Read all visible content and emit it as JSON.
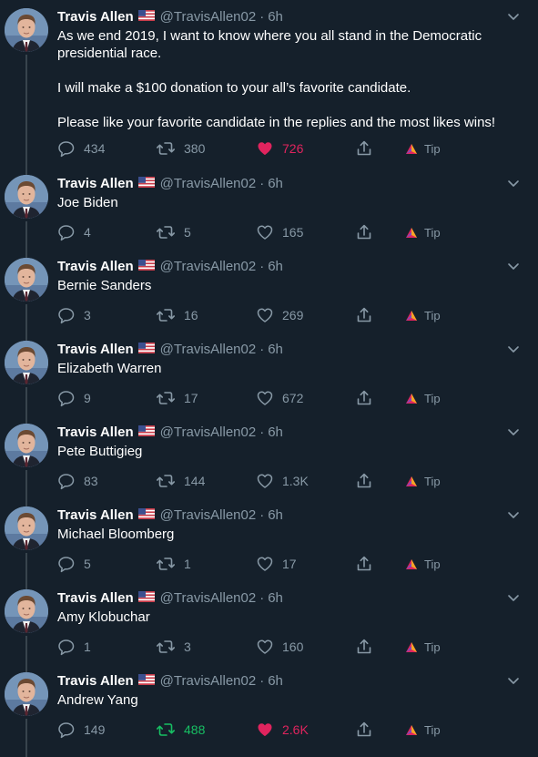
{
  "author": {
    "name": "Travis Allen",
    "handle": "@TravisAllen02",
    "time": "6h",
    "flag_icon": "us-flag-icon"
  },
  "colors": {
    "background": "#15202b",
    "text": "#ffffff",
    "muted": "#8899a6",
    "like_active": "#e0245e",
    "retweet_active": "#17bf63",
    "thread_line": "#38444d"
  },
  "tweets": [
    {
      "paragraphs": [
        "As we end 2019, I want to know where you all stand in the Democratic presidential race.",
        "I will make a $100 donation to your all’s favorite candidate.",
        "Please like your favorite candidate in the replies and the most likes wins!"
      ],
      "replies": "434",
      "retweets": "380",
      "likes": "726",
      "liked": true,
      "retweeted": false,
      "tip_label": "Tip"
    },
    {
      "paragraphs": [
        "Joe Biden"
      ],
      "replies": "4",
      "retweets": "5",
      "likes": "165",
      "liked": false,
      "retweeted": false,
      "tip_label": "Tip"
    },
    {
      "paragraphs": [
        "Bernie Sanders"
      ],
      "replies": "3",
      "retweets": "16",
      "likes": "269",
      "liked": false,
      "retweeted": false,
      "tip_label": "Tip"
    },
    {
      "paragraphs": [
        "Elizabeth Warren"
      ],
      "replies": "9",
      "retweets": "17",
      "likes": "672",
      "liked": false,
      "retweeted": false,
      "tip_label": "Tip"
    },
    {
      "paragraphs": [
        "Pete Buttigieg"
      ],
      "replies": "83",
      "retweets": "144",
      "likes": "1.3K",
      "liked": false,
      "retweeted": false,
      "tip_label": "Tip"
    },
    {
      "paragraphs": [
        "Michael Bloomberg"
      ],
      "replies": "5",
      "retweets": "1",
      "likes": "17",
      "liked": false,
      "retweeted": false,
      "tip_label": "Tip"
    },
    {
      "paragraphs": [
        "Amy Klobuchar"
      ],
      "replies": "1",
      "retweets": "3",
      "likes": "160",
      "liked": false,
      "retweeted": false,
      "tip_label": "Tip"
    },
    {
      "paragraphs": [
        "Andrew Yang"
      ],
      "replies": "149",
      "retweets": "488",
      "likes": "2.6K",
      "liked": true,
      "retweeted": true,
      "tip_label": "Tip"
    }
  ]
}
